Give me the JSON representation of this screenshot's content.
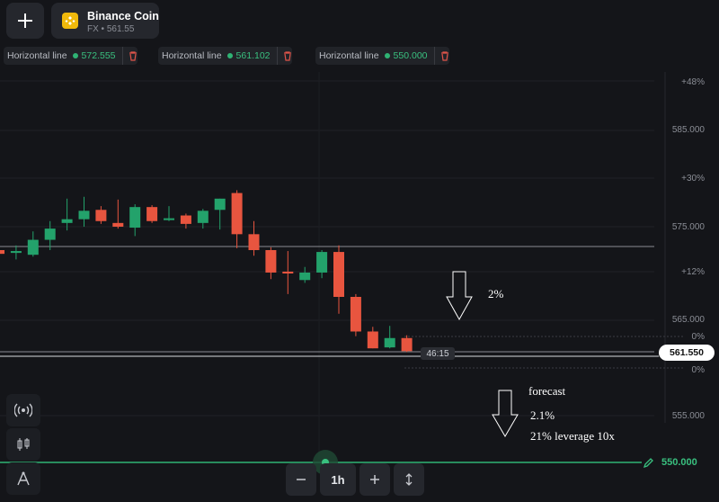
{
  "asset": {
    "name": "Binance Coin",
    "sub": "FX • 561.55"
  },
  "horizontal_lines": [
    {
      "label": "Horizontal line",
      "value": "572.555"
    },
    {
      "label": "Horizontal line",
      "value": "561.102"
    },
    {
      "label": "Horizontal line",
      "value": "550.000"
    }
  ],
  "price_axis": {
    "p48": "+48%",
    "p585": "585.000",
    "p30": "+30%",
    "p575": "575.000",
    "p12": "+12%",
    "p565": "565.000",
    "p0a": "0%",
    "p0b": "0%",
    "p555": "555.000"
  },
  "current_price": "561.550",
  "timer": "46:15",
  "timeframe": "1h",
  "target_line": "550.000",
  "annotations": {
    "pct2": "2%",
    "forecast": "forecast",
    "pct21": "2.1%",
    "leverage": "21% leverage 10x"
  },
  "icons": {
    "add": "plus-icon",
    "coin": "binance-coin-icon",
    "trash": "trash-icon",
    "signal": "signal-icon",
    "candles": "candles-icon",
    "draw": "drawing-tools-icon",
    "pencil": "pencil-icon",
    "zoom_out": "minus-icon",
    "zoom_in": "plus-icon",
    "resize": "vertical-resize-icon"
  },
  "chart_data": {
    "type": "candlestick",
    "y_range": [
      549,
      590
    ],
    "candles": [
      {
        "o": 572.5,
        "h": 573.0,
        "l": 571.8,
        "c": 572.1
      },
      {
        "o": 572.2,
        "h": 573.0,
        "l": 571.5,
        "c": 572.4
      },
      {
        "o": 572.0,
        "h": 574.5,
        "l": 571.8,
        "c": 573.6
      },
      {
        "o": 573.6,
        "h": 575.6,
        "l": 572.5,
        "c": 574.8
      },
      {
        "o": 575.4,
        "h": 578.0,
        "l": 574.6,
        "c": 575.8
      },
      {
        "o": 575.8,
        "h": 578.2,
        "l": 575.0,
        "c": 576.7
      },
      {
        "o": 576.8,
        "h": 577.2,
        "l": 575.3,
        "c": 575.6
      },
      {
        "o": 575.4,
        "h": 577.9,
        "l": 574.8,
        "c": 575.0
      },
      {
        "o": 574.9,
        "h": 577.4,
        "l": 574.0,
        "c": 577.1
      },
      {
        "o": 577.1,
        "h": 577.3,
        "l": 575.4,
        "c": 575.6
      },
      {
        "o": 575.8,
        "h": 577.2,
        "l": 575.6,
        "c": 575.9
      },
      {
        "o": 576.2,
        "h": 576.4,
        "l": 574.8,
        "c": 575.3
      },
      {
        "o": 575.4,
        "h": 576.9,
        "l": 574.8,
        "c": 576.7
      },
      {
        "o": 576.8,
        "h": 578.0,
        "l": 574.7,
        "c": 578.0
      },
      {
        "o": 578.6,
        "h": 578.9,
        "l": 572.7,
        "c": 574.2
      },
      {
        "o": 574.2,
        "h": 575.6,
        "l": 571.9,
        "c": 572.5
      },
      {
        "o": 572.5,
        "h": 572.8,
        "l": 569.4,
        "c": 570.1
      },
      {
        "o": 570.2,
        "h": 572.4,
        "l": 567.8,
        "c": 570.0
      },
      {
        "o": 569.3,
        "h": 570.7,
        "l": 569.0,
        "c": 570.1
      },
      {
        "o": 570.1,
        "h": 572.5,
        "l": 569.5,
        "c": 572.3
      },
      {
        "o": 572.3,
        "h": 573.0,
        "l": 565.7,
        "c": 567.5
      },
      {
        "o": 567.5,
        "h": 567.8,
        "l": 563.3,
        "c": 563.8
      },
      {
        "o": 563.8,
        "h": 564.3,
        "l": 562.0,
        "c": 562.0
      },
      {
        "o": 562.1,
        "h": 564.4,
        "l": 562.0,
        "c": 563.1
      },
      {
        "o": 563.1,
        "h": 563.4,
        "l": 561.6,
        "c": 561.7
      }
    ]
  }
}
